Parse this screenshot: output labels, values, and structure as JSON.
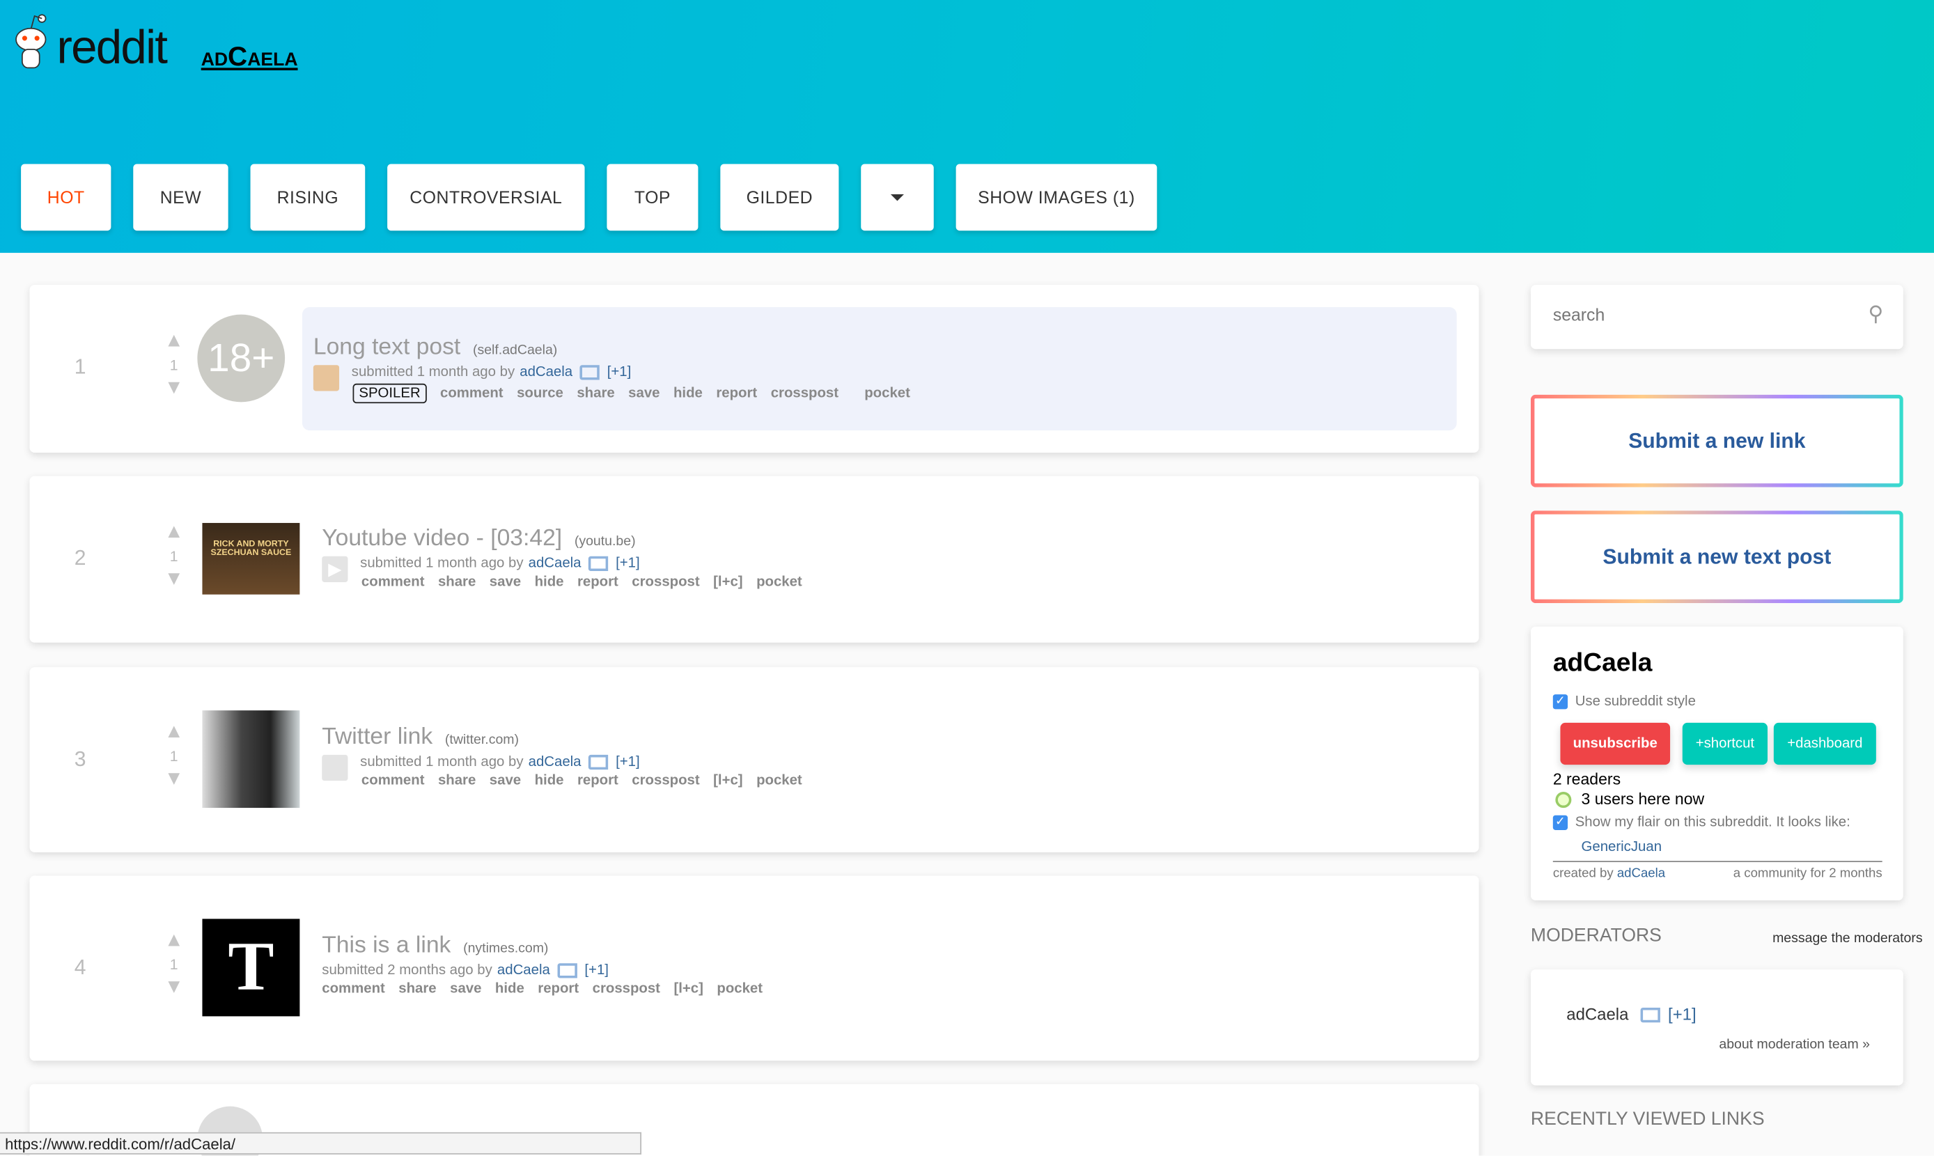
{
  "header": {
    "logo_text": "reddit",
    "subreddit": "adCaela"
  },
  "tabs": [
    {
      "label": "HOT",
      "selected": true
    },
    {
      "label": "NEW"
    },
    {
      "label": "RISING"
    },
    {
      "label": "CONTROVERSIAL"
    },
    {
      "label": "TOP"
    },
    {
      "label": "GILDED"
    },
    {
      "label": "",
      "icon": "filter-icon"
    },
    {
      "label": "SHOW IMAGES (1)"
    }
  ],
  "posts": [
    {
      "rank": "1",
      "score": "1",
      "thumb": "18+",
      "title": "Long text post",
      "domain": "(self.adCaela)",
      "tagline": "submitted 1 month ago by",
      "author": "adCaela",
      "plus": "[+1]",
      "spoiler": "SPOILER",
      "actions": [
        "comment",
        "source",
        "share",
        "save",
        "hide",
        "report",
        "crosspost",
        "pocket"
      ]
    },
    {
      "rank": "2",
      "score": "1",
      "thumb_text": "RICK AND MORTY SZECHUAN SAUCE",
      "title": "Youtube video - [03:42]",
      "domain": "(youtu.be)",
      "tagline": "submitted 1 month ago by",
      "author": "adCaela",
      "plus": "[+1]",
      "actions": [
        "comment",
        "share",
        "save",
        "hide",
        "report",
        "crosspost",
        "[l+c]",
        "pocket"
      ]
    },
    {
      "rank": "3",
      "score": "1",
      "title": "Twitter link",
      "domain": "(twitter.com)",
      "tagline": "submitted 1 month ago by",
      "author": "adCaela",
      "plus": "[+1]",
      "actions": [
        "comment",
        "share",
        "save",
        "hide",
        "report",
        "crosspost",
        "[l+c]",
        "pocket"
      ]
    },
    {
      "rank": "4",
      "score": "1",
      "thumb_text": "T",
      "title": "This is a link",
      "domain": "(nytimes.com)",
      "tagline": "submitted 2 months ago by",
      "author": "adCaela",
      "plus": "[+1]",
      "actions": [
        "comment",
        "share",
        "save",
        "hide",
        "report",
        "crosspost",
        "[l+c]",
        "pocket"
      ]
    }
  ],
  "sidebar": {
    "search_placeholder": "search",
    "submit_link": "Submit a new link",
    "submit_text": "Submit a new text post",
    "name": "adCaela",
    "use_style": "Use subreddit style",
    "unsubscribe": "unsubscribe",
    "shortcut": "+shortcut",
    "dashboard": "+dashboard",
    "readers": "2 readers",
    "here_now": "3 users here now",
    "flair_label": "Show my flair on this subreddit. It looks like:",
    "flair": "GenericJuan",
    "created_by": "created by",
    "creator": "adCaela",
    "age": "a community for 2 months",
    "moderators_heading": "MODERATORS",
    "message_mods": "message the moderators",
    "moderator": "adCaela",
    "mod_plus": "[+1]",
    "about_mods": "about moderation team »",
    "recent_heading": "RECENTLY VIEWED LINKS"
  },
  "status_url": "https://www.reddit.com/r/adCaela/",
  "colors": {
    "accent": "#ff4500",
    "header_start": "#00b5de",
    "header_end": "#00c9c6",
    "unsubscribe": "#ef4447",
    "teal": "#00cbb8"
  }
}
